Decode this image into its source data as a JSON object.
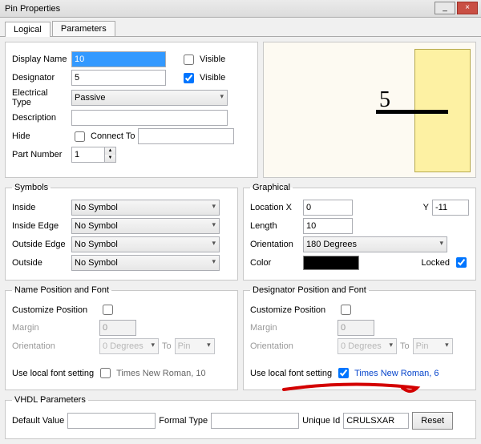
{
  "window": {
    "title": "Pin Properties"
  },
  "tabs": {
    "logical": "Logical",
    "parameters": "Parameters"
  },
  "main": {
    "displayName_label": "Display Name",
    "displayName_value": "10",
    "displayName_visible_label": "Visible",
    "displayName_visible": false,
    "designator_label": "Designator",
    "designator_value": "5",
    "designator_visible_label": "Visible",
    "designator_visible": true,
    "electricalType_label": "Electrical Type",
    "electricalType_value": "Passive",
    "description_label": "Description",
    "description_value": "",
    "hide_label": "Hide",
    "hide_checked": false,
    "connectTo_label": "Connect To",
    "connectTo_value": "",
    "partNumber_label": "Part Number",
    "partNumber_value": "1"
  },
  "preview": {
    "number": "5"
  },
  "symbols": {
    "legend": "Symbols",
    "inside_label": "Inside",
    "inside_value": "No Symbol",
    "insideEdge_label": "Inside Edge",
    "insideEdge_value": "No Symbol",
    "outsideEdge_label": "Outside Edge",
    "outsideEdge_value": "No Symbol",
    "outside_label": "Outside",
    "outside_value": "No Symbol"
  },
  "graphical": {
    "legend": "Graphical",
    "locationX_label": "Location  X",
    "locationX_value": "0",
    "locationY_label": "Y",
    "locationY_value": "-11",
    "length_label": "Length",
    "length_value": "10",
    "orientation_label": "Orientation",
    "orientation_value": "180 Degrees",
    "color_label": "Color",
    "color_value": "#000000",
    "locked_label": "Locked",
    "locked": true
  },
  "namePos": {
    "legend": "Name Position and Font",
    "customize_label": "Customize Position",
    "customize": false,
    "margin_label": "Margin",
    "margin_value": "0",
    "orientation_label": "Orientation",
    "orientation_value": "0 Degrees",
    "to_label": "To",
    "to_value": "Pin",
    "useLocal_label": "Use local font setting",
    "useLocal": false,
    "font_link": "Times New Roman, 10"
  },
  "desigPos": {
    "legend": "Designator Position and Font",
    "customize_label": "Customize Position",
    "customize": false,
    "margin_label": "Margin",
    "margin_value": "0",
    "orientation_label": "Orientation",
    "orientation_value": "0 Degrees",
    "to_label": "To",
    "to_value": "Pin",
    "useLocal_label": "Use local font setting",
    "useLocal": true,
    "font_link": "Times New Roman, 6"
  },
  "vhdl": {
    "legend": "VHDL Parameters",
    "defaultValue_label": "Default Value",
    "defaultValue_value": "",
    "formalType_label": "Formal Type",
    "formalType_value": "",
    "uniqueId_label": "Unique Id",
    "uniqueId_value": "CRULSXAR",
    "reset_label": "Reset"
  }
}
